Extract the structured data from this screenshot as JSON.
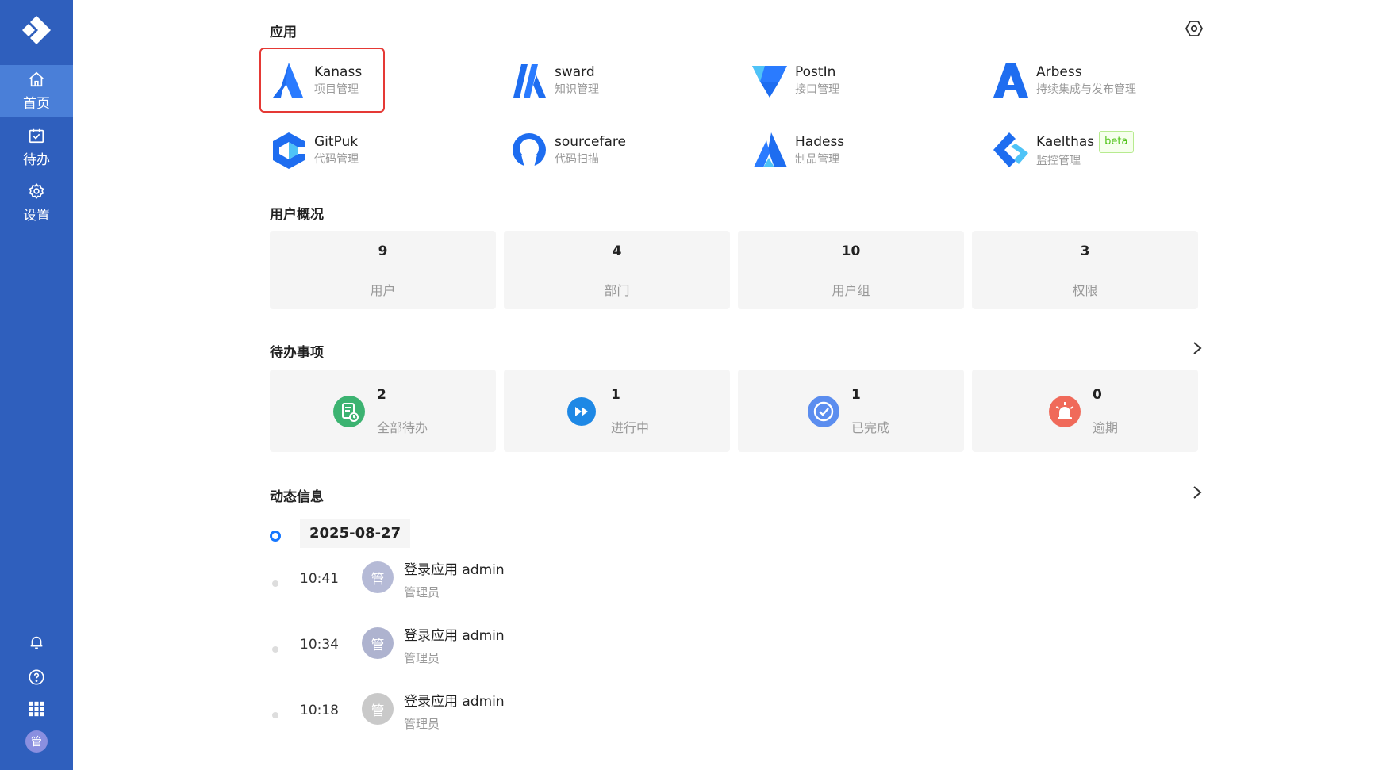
{
  "sidebar": {
    "nav": [
      {
        "label": "首页",
        "icon": "home-icon",
        "active": true
      },
      {
        "label": "待办",
        "icon": "calendar-check-icon",
        "active": false
      },
      {
        "label": "设置",
        "icon": "gear-icon",
        "active": false
      }
    ],
    "avatar_text": "管"
  },
  "apps": {
    "title": "应用",
    "items": [
      {
        "name": "Kanass",
        "desc": "项目管理"
      },
      {
        "name": "sward",
        "desc": "知识管理"
      },
      {
        "name": "PostIn",
        "desc": "接口管理"
      },
      {
        "name": "Arbess",
        "desc": "持续集成与发布管理"
      },
      {
        "name": "GitPuk",
        "desc": "代码管理"
      },
      {
        "name": "sourcefare",
        "desc": "代码扫描"
      },
      {
        "name": "Hadess",
        "desc": "制品管理"
      },
      {
        "name": "Kaelthas",
        "desc": "监控管理",
        "badge": "beta"
      }
    ]
  },
  "overview": {
    "title": "用户概况",
    "stats": [
      {
        "value": "9",
        "label": "用户"
      },
      {
        "value": "4",
        "label": "部门"
      },
      {
        "value": "10",
        "label": "用户组"
      },
      {
        "value": "3",
        "label": "权限"
      }
    ]
  },
  "todos": {
    "title": "待办事项",
    "items": [
      {
        "value": "2",
        "label": "全部待办",
        "color": "#3cb371"
      },
      {
        "value": "1",
        "label": "进行中",
        "color": "#1e88e5"
      },
      {
        "value": "1",
        "label": "已完成",
        "color": "#5b8def"
      },
      {
        "value": "0",
        "label": "逾期",
        "color": "#f06a5a"
      }
    ]
  },
  "activity": {
    "title": "动态信息",
    "date": "2025-08-27",
    "entries": [
      {
        "time": "10:41",
        "avatar": "管",
        "action": "登录应用 admin",
        "role": "管理员"
      },
      {
        "time": "10:34",
        "avatar": "管",
        "action": "登录应用 admin",
        "role": "管理员"
      },
      {
        "time": "10:18",
        "avatar": "管",
        "action": "登录应用 admin",
        "role": "管理员"
      }
    ]
  }
}
